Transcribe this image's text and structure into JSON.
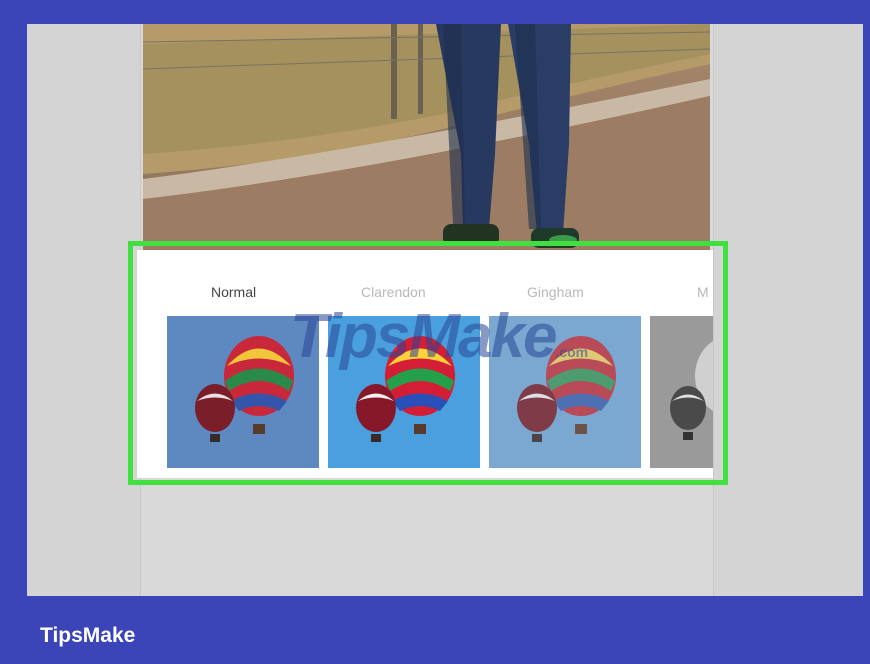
{
  "filters": [
    {
      "label": "Normal",
      "active": true,
      "tone": "normal"
    },
    {
      "label": "Clarendon",
      "active": false,
      "tone": "clarendon"
    },
    {
      "label": "Gingham",
      "active": false,
      "tone": "gingham"
    },
    {
      "label": "M",
      "active": false,
      "tone": "mono"
    }
  ],
  "watermark": {
    "main": "TipsMake",
    "suffix": ".com"
  },
  "footer": {
    "brand": "TipsMake"
  },
  "colors": {
    "border": "#3b45b8",
    "highlight": "#3fe03f"
  }
}
